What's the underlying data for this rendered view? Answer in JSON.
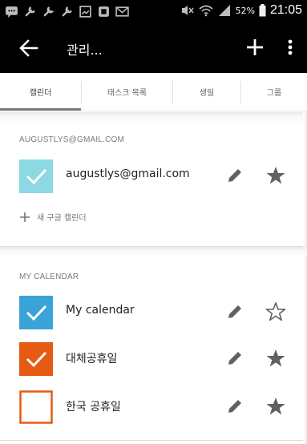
{
  "status_bar": {
    "battery": "52%",
    "time": "21:05"
  },
  "appbar": {
    "title": "관리..."
  },
  "tabs": [
    {
      "label": "캘린더",
      "active": true
    },
    {
      "label": "태스크 목록",
      "active": false
    },
    {
      "label": "생일",
      "active": false
    },
    {
      "label": "그룹",
      "active": false
    }
  ],
  "account_section": {
    "header": "AUGUSTLYS@GMAIL.COM",
    "calendars": [
      {
        "label": "augustlys@gmail.com",
        "color": "#8dd9e3",
        "checked": true,
        "starred": true
      }
    ],
    "add_label": "새 구글 캘린더"
  },
  "my_section": {
    "header": "MY CALENDAR",
    "calendars": [
      {
        "label": "My calendar",
        "color": "#3aa3d8",
        "checked": true,
        "starred": false
      },
      {
        "label": "대체공휴일",
        "color": "#e65a13",
        "checked": true,
        "starred": true
      },
      {
        "label": "한국 공휴일",
        "color": "#e65a13",
        "checked": false,
        "starred": true
      }
    ]
  }
}
